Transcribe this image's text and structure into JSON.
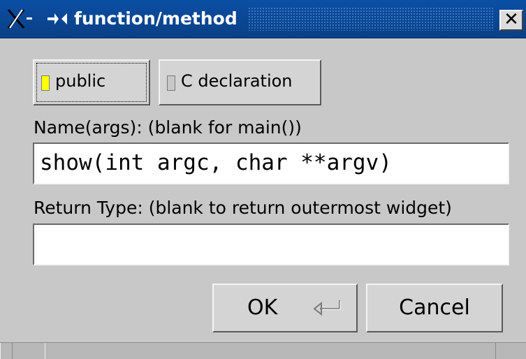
{
  "window": {
    "title": "function/method",
    "close_label": "✕"
  },
  "toggles": {
    "public": {
      "label": "public",
      "lit": true,
      "light_color": "#ffff00"
    },
    "c_declaration": {
      "label": "C declaration",
      "lit": false,
      "light_color": "#c8c8c8"
    }
  },
  "name_field": {
    "label": "Name(args): (blank for main())",
    "value": "show(int argc, char **argv)"
  },
  "return_field": {
    "label": "Return Type: (blank to return outermost widget)",
    "value": ""
  },
  "buttons": {
    "ok_label": "OK",
    "ok_icon": "return-arrow-icon",
    "cancel_label": "Cancel"
  },
  "colors": {
    "titlebar": "#0b4fa3",
    "background": "#c8c8c8",
    "accent_light": "#ffff00"
  }
}
